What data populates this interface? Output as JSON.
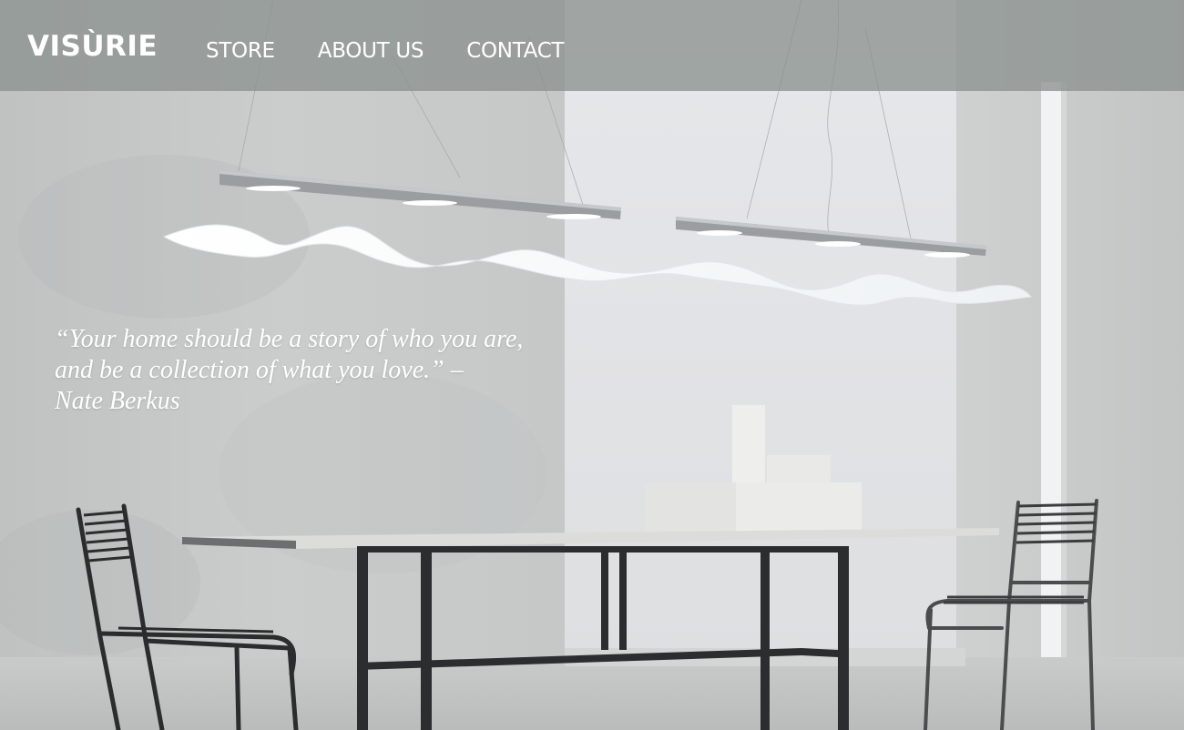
{
  "brand": {
    "logo": "VISÙRIE"
  },
  "nav": {
    "store": "STORE",
    "about": "ABOUT US",
    "contact": "CONTACT"
  },
  "hero": {
    "quote_line1": "“Your home should be a story of who you are,",
    "quote_line2": "and be a collection of what you love.” –",
    "quote_author": "Nate Berkus"
  },
  "colors": {
    "header_overlay": "#8c928f",
    "text": "#ffffff"
  }
}
